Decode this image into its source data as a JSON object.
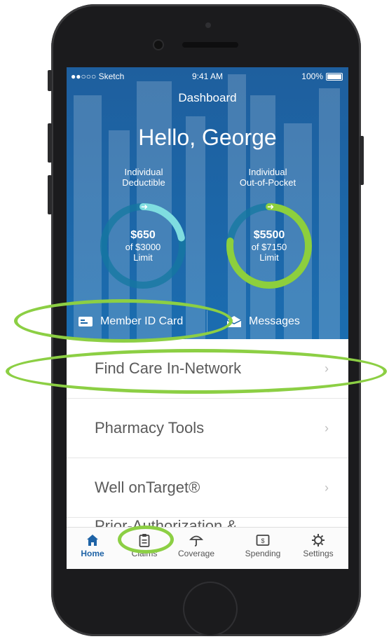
{
  "status_bar": {
    "carrier": "●●○○○ Sketch",
    "time": "9:41 AM",
    "battery": "100%"
  },
  "header": {
    "title": "Dashboard",
    "greeting": "Hello, George"
  },
  "deductible": {
    "label_line1": "Individual",
    "label_line2": "Deductible",
    "amount": "$650",
    "of_text": "of $3000",
    "limit_text": "Limit",
    "progress": 0.2167,
    "color": "#7fdde0"
  },
  "oop": {
    "label_line1": "Individual",
    "label_line2": "Out-of-Pocket",
    "amount": "$5500",
    "of_text": "of $7150",
    "limit_text": "Limit",
    "progress": 0.7692,
    "color": "#8dcf3d"
  },
  "actions": {
    "member_id": "Member ID Card",
    "messages": "Messages"
  },
  "list": [
    {
      "label": "Find Care In-Network"
    },
    {
      "label": "Pharmacy Tools"
    },
    {
      "label": "Well onTarget®"
    }
  ],
  "partial_item": "Prior-Authorization &",
  "tabs": [
    {
      "label": "Home",
      "icon": "home-icon"
    },
    {
      "label": "Claims",
      "icon": "clipboard-icon"
    },
    {
      "label": "Coverage",
      "icon": "umbrella-icon"
    },
    {
      "label": "Spending",
      "icon": "dollar-icon"
    },
    {
      "label": "Settings",
      "icon": "gear-icon"
    }
  ],
  "colors": {
    "brand_blue": "#1c67a9",
    "highlight_green": "#8ccf44",
    "active_tab": "#1e63a6"
  }
}
